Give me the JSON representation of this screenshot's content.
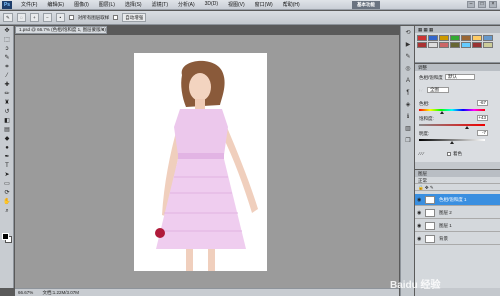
{
  "menubar": {
    "app_icon": "Ps",
    "items": [
      "文件(F)",
      "编辑(E)",
      "图像(I)",
      "图层(L)",
      "选择(S)",
      "滤镜(T)",
      "分析(A)",
      "3D(D)",
      "视图(V)",
      "窗口(W)",
      "帮助(H)"
    ],
    "workspace": "基本功能"
  },
  "options": {
    "checkbox_label": "对所有图层取样",
    "enhance_label": "自动增强"
  },
  "document": {
    "tab_title": "1.psd @ 66.7% (色相/饱和度 1, 图层蒙版/8)"
  },
  "status": {
    "zoom": "66.67%",
    "doc": "文档:1.22M/3.07M"
  },
  "adjustments": {
    "title": "调整",
    "preset_label": "色相/饱和度",
    "preset_value": "默认",
    "channel_value": "全图",
    "hue_label": "色相:",
    "hue_value": "-67",
    "saturation_label": "饱和度:",
    "saturation_value": "+43",
    "lightness_label": "明度:",
    "lightness_value": "-7",
    "colorize_label": "着色"
  },
  "layers": {
    "title": "图层",
    "blend_mode": "正常",
    "items": [
      {
        "name": "色相/饱和度 1",
        "active": true
      },
      {
        "name": "图层 2",
        "active": false
      },
      {
        "name": "图层 1",
        "active": false
      },
      {
        "name": "背景",
        "active": false
      }
    ]
  },
  "watermark": "Baidu 经验",
  "colors": {
    "canvas": "#9b9b9b",
    "dress": "#ecc8ec",
    "highlight": "#3a8fe0"
  }
}
